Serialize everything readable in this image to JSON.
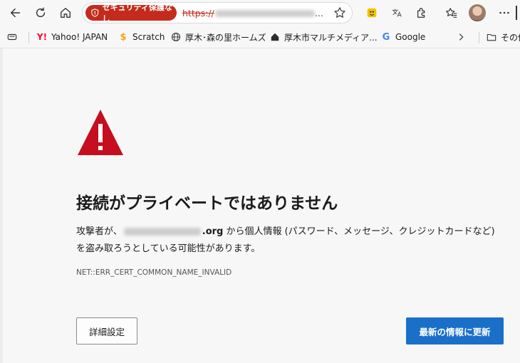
{
  "toolbar": {
    "security_badge": "セキュリティ保護なし",
    "url_scheme": "https://",
    "url_ellipsis": "..."
  },
  "icons": {
    "back": "back-arrow-icon",
    "reload": "reload-icon",
    "home": "home-icon",
    "favorite": "star-icon",
    "extensions": "puzzle-icon",
    "favorites_list": "favorites-icon",
    "more": "more-icon"
  },
  "bookmarks": [
    {
      "label": "Yahoo! JAPAN",
      "icon": "yahoo-icon"
    },
    {
      "label": "Scratch",
      "icon": "scratch-icon"
    },
    {
      "label": "厚木･森の里ホームズ",
      "icon": "globe-icon"
    },
    {
      "label": "厚木市マルチメディア...",
      "icon": "house-icon"
    },
    {
      "label": "Google",
      "icon": "google-icon"
    },
    {
      "label": "その他",
      "icon": "folder-icon"
    }
  ],
  "page": {
    "title": "接続がプライベートではありません",
    "desc_prefix": "攻撃者が、",
    "domain_suffix": ".org",
    "desc_suffix": " から個人情報 (パスワード、メッセージ、クレジットカードなど) を盗み取ろうとしている可能性があります。",
    "error_code": "NET::ERR_CERT_COMMON_NAME_INVALID",
    "advanced_button": "詳細設定",
    "back_button": "最新の情報に更新"
  },
  "colors": {
    "warning_red": "#c42b1c",
    "primary_blue": "#1a6fc9",
    "background": "#f7f7f7"
  }
}
